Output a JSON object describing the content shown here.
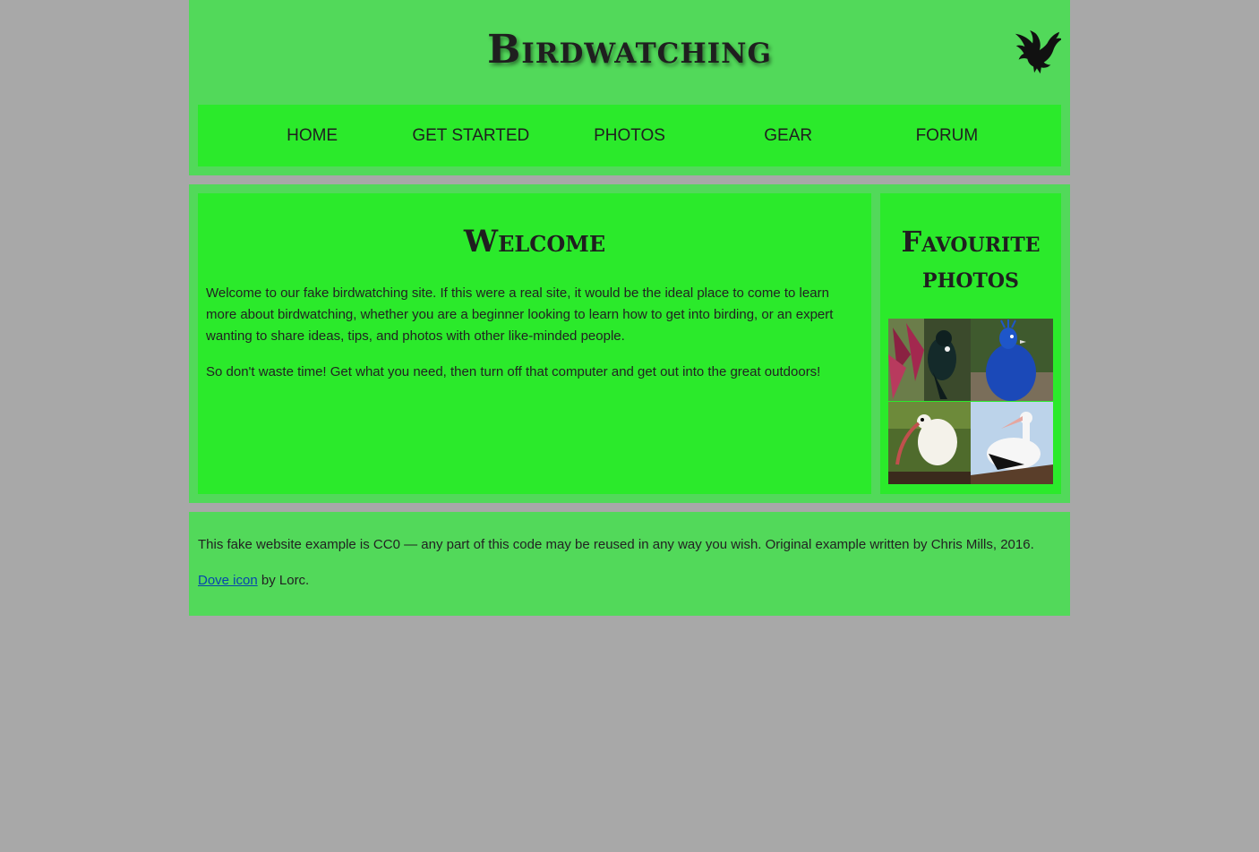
{
  "header": {
    "title": "Birdwatching",
    "logo_icon": "dove-icon"
  },
  "nav": {
    "items": [
      "Home",
      "Get started",
      "Photos",
      "Gear",
      "Forum"
    ]
  },
  "main": {
    "heading": "Welcome",
    "paragraphs": [
      "Welcome to our fake birdwatching site. If this were a real site, it would be the ideal place to come to learn more about birdwatching, whether you are a beginner looking to learn how to get into birding, or an expert wanting to share ideas, tips, and photos with other like-minded people.",
      "So don't waste time! Get what you need, then turn off that computer and get out into the great outdoors!"
    ]
  },
  "aside": {
    "heading": "Favourite photos",
    "photos": [
      "tui-bird-photo",
      "peacock-photo",
      "ibis-photo",
      "stork-photo"
    ]
  },
  "footer": {
    "credit": "This fake website example is CC0 — any part of this code may be reused in any way you wish. Original example written by Chris Mills, 2016.",
    "icon_link": "Dove icon",
    "icon_by": " by Lorc."
  },
  "colors": {
    "background": "#a8a8a8",
    "panel": "#52d95a",
    "accent": "#2bea2b",
    "text": "#1f1f1f"
  }
}
